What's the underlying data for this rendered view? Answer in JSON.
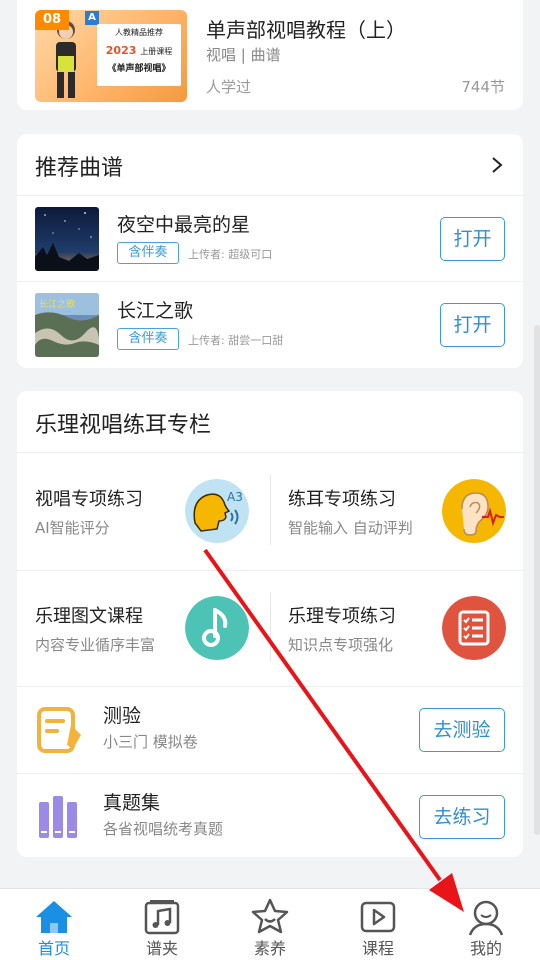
{
  "course": {
    "thumb_badge": "08",
    "thumb_badge_a": "A",
    "thumb_line1": "人教精品推荐",
    "thumb_year": "2023",
    "thumb_year_suffix": "上册课程",
    "thumb_line3": "《单声部视唱》",
    "title": "单声部视唱教程（上）",
    "subtitle": "视唱 | 曲谱",
    "learned": "人学过",
    "lessons": "744节"
  },
  "scores": {
    "title": "推荐曲谱",
    "items": [
      {
        "name": "夜空中最亮的星",
        "tag": "含伴奏",
        "uploader": "上传者: 超级可口",
        "action": "打开"
      },
      {
        "name": "长江之歌",
        "tag": "含伴奏",
        "uploader": "上传者: 甜尝一口甜",
        "action": "打开",
        "thumb_text": "长江之歌"
      }
    ]
  },
  "theory": {
    "title": "乐理视唱练耳专栏",
    "grid": [
      {
        "title": "视唱专项练习",
        "sub": "AI智能评分",
        "icon": "singing-head-icon",
        "icon_text": "A3",
        "color": "#f5b700"
      },
      {
        "title": "练耳专项练习",
        "sub": "智能输入 自动评判",
        "icon": "ear-icon",
        "color": "#f5b700"
      },
      {
        "title": "乐理图文课程",
        "sub": "内容专业循序丰富",
        "icon": "music-note-icon",
        "color": "#4cc3b5"
      },
      {
        "title": "乐理专项练习",
        "sub": "知识点专项强化",
        "icon": "checklist-icon",
        "color": "#e0533f"
      }
    ],
    "list": [
      {
        "title": "测验",
        "sub": "小三门 模拟卷",
        "action": "去测验",
        "icon": "quiz-icon",
        "color": "#f3b23b"
      },
      {
        "title": "真题集",
        "sub": "各省视唱统考真题",
        "action": "去练习",
        "icon": "books-icon",
        "color": "#9b8ae6"
      }
    ]
  },
  "tabs": [
    {
      "label": "首页",
      "icon": "home-icon",
      "active": true
    },
    {
      "label": "谱夹",
      "icon": "sheet-music-icon"
    },
    {
      "label": "素养",
      "icon": "star-face-icon"
    },
    {
      "label": "课程",
      "icon": "play-course-icon"
    },
    {
      "label": "我的",
      "icon": "profile-icon"
    }
  ],
  "colors": {
    "accent": "#1a8fe3",
    "annotation": "#e8141a"
  }
}
